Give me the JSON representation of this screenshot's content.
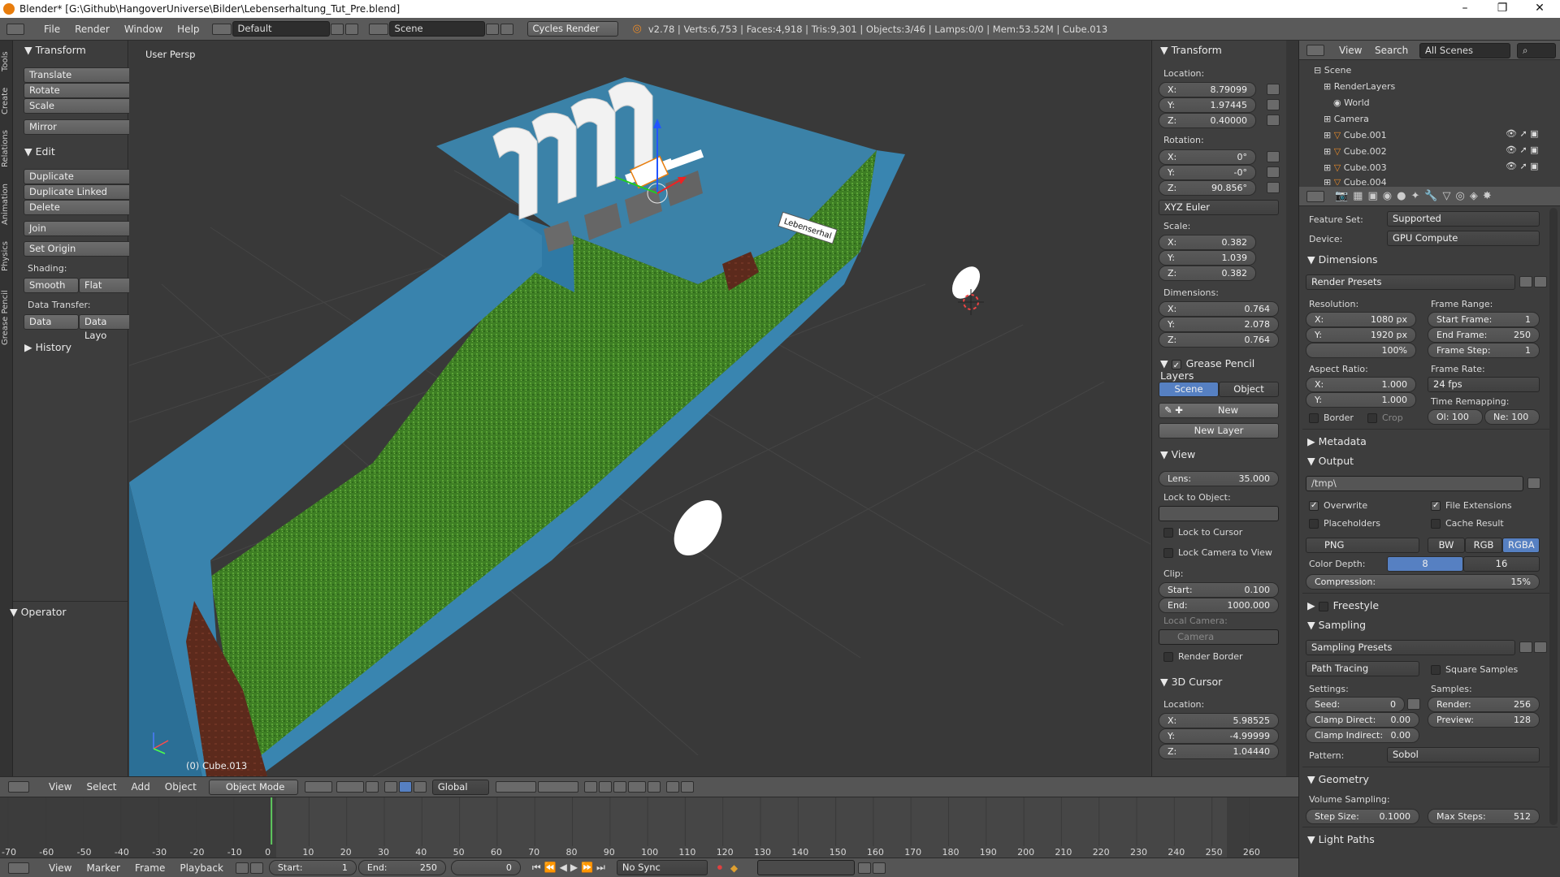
{
  "window": {
    "title": "Blender* [G:\\Github\\HangoverUniverse\\Bilder\\Lebenserhaltung_Tut_Pre.blend]",
    "minimize": "–",
    "maximize": "❐",
    "close": "✕"
  },
  "info_header": {
    "menus": [
      "File",
      "Render",
      "Window",
      "Help"
    ],
    "layout": "Default",
    "scene": "Scene",
    "engine": "Cycles Render",
    "stats": "v2.78 | Verts:6,753 | Faces:4,918 | Tris:9,301 | Objects:3/46 | Lamps:0/0 | Mem:53.52M | Cube.013"
  },
  "tool_tabs": [
    "Tools",
    "Create",
    "Relations",
    "Animation",
    "Physics",
    "Grease Pencil"
  ],
  "toolshelf": {
    "transform_header": "Transform",
    "transform_buttons": [
      "Translate",
      "Rotate",
      "Scale"
    ],
    "mirror": "Mirror",
    "edit_header": "Edit",
    "edit_buttons": [
      "Duplicate",
      "Duplicate Linked",
      "Delete"
    ],
    "join": "Join",
    "set_origin": "Set Origin",
    "shading_label": "Shading:",
    "smooth": "Smooth",
    "flat": "Flat",
    "data_transfer_label": "Data Transfer:",
    "data": "Data",
    "data_layo": "Data Layo",
    "history": "History",
    "operator": "Operator"
  },
  "viewport": {
    "persp_label": "User Persp",
    "object_label": "(0) Cube.013",
    "sign_text": "Lebenserhal"
  },
  "npanel": {
    "transform": "Transform",
    "location_label": "Location:",
    "loc": {
      "x": "8.79099",
      "y": "1.97445",
      "z": "0.40000"
    },
    "rotation_label": "Rotation:",
    "rot": {
      "x": "0°",
      "y": "-0°",
      "z": "90.856°"
    },
    "rot_mode": "XYZ Euler",
    "scale_label": "Scale:",
    "scale": {
      "x": "0.382",
      "y": "1.039",
      "z": "0.382"
    },
    "dimensions_label": "Dimensions:",
    "dim": {
      "x": "0.764",
      "y": "2.078",
      "z": "0.764"
    },
    "grease_pencil": "Grease Pencil Layers",
    "scene_tab": "Scene",
    "object_tab": "Object",
    "new": "New",
    "new_layer": "New Layer",
    "view": "View",
    "lens_label": "Lens:",
    "lens": "35.000",
    "lock_to_object": "Lock to Object:",
    "lock_to_cursor": "Lock to Cursor",
    "lock_camera": "Lock Camera to View",
    "clip_label": "Clip:",
    "clip_start_label": "Start:",
    "clip_start": "0.100",
    "clip_end_label": "End:",
    "clip_end": "1000.000",
    "local_camera": "Local Camera:",
    "camera": "Camera",
    "render_border": "Render Border",
    "cursor": "3D Cursor",
    "cursor_location": "Location:",
    "cur": {
      "x": "5.98525",
      "y": "-4.99999",
      "z": "1.04440"
    },
    "axis": {
      "x": "X:",
      "y": "Y:",
      "z": "Z:"
    }
  },
  "outliner": {
    "menus": [
      "View",
      "Search"
    ],
    "filter": "All Scenes",
    "items": [
      "Scene",
      "RenderLayers",
      "World",
      "Camera",
      "Cube.001",
      "Cube.002",
      "Cube.003",
      "Cube.004"
    ]
  },
  "properties": {
    "feature_set_label": "Feature Set:",
    "feature_set": "Supported",
    "device_label": "Device:",
    "device": "GPU Compute",
    "dimensions": "Dimensions",
    "render_presets": "Render Presets",
    "resolution_label": "Resolution:",
    "res_x": "1080 px",
    "res_y": "1920 px",
    "res_pct": "100%",
    "frame_range_label": "Frame Range:",
    "start_frame_label": "Start Frame:",
    "start_frame": "1",
    "end_frame_label": "End Frame:",
    "end_frame": "250",
    "frame_step_label": "Frame Step:",
    "frame_step": "1",
    "aspect_label": "Aspect Ratio:",
    "aspect_x": "1.000",
    "aspect_y": "1.000",
    "frame_rate_label": "Frame Rate:",
    "frame_rate": "24 fps",
    "time_remap_label": "Time Remapping:",
    "old": "Ol: 100",
    "new": "Ne: 100",
    "border": "Border",
    "crop": "Crop",
    "metadata": "Metadata",
    "output": "Output",
    "output_path": "/tmp\\",
    "overwrite": "Overwrite",
    "file_extensions": "File Extensions",
    "placeholders": "Placeholders",
    "cache_result": "Cache Result",
    "format": "PNG",
    "bw": "BW",
    "rgb": "RGB",
    "rgba": "RGBA",
    "color_depth_label": "Color Depth:",
    "depth8": "8",
    "depth16": "16",
    "compression_label": "Compression:",
    "compression": "15%",
    "freestyle": "Freestyle",
    "sampling": "Sampling",
    "sampling_presets": "Sampling Presets",
    "path_tracing": "Path Tracing",
    "square_samples": "Square Samples",
    "settings_label": "Settings:",
    "samples_label": "Samples:",
    "seed_label": "Seed:",
    "seed": "0",
    "render_label": "Render:",
    "render": "256",
    "clamp_direct_label": "Clamp Direct:",
    "clamp_direct": "0.00",
    "preview_label": "Preview:",
    "preview": "128",
    "clamp_indirect_label": "Clamp Indirect:",
    "clamp_indirect": "0.00",
    "pattern_label": "Pattern:",
    "pattern": "Sobol",
    "geometry": "Geometry",
    "volume_sampling": "Volume Sampling:",
    "step_size_label": "Step Size:",
    "step_size": "0.1000",
    "max_steps_label": "Max Steps:",
    "max_steps": "512",
    "light_paths": "Light Paths"
  },
  "viewport_header": {
    "menus": [
      "View",
      "Select",
      "Add",
      "Object"
    ],
    "mode": "Object Mode",
    "orientation": "Global"
  },
  "timeline": {
    "ticks": [
      "-70",
      "-60",
      "-50",
      "-40",
      "-30",
      "-20",
      "-10",
      "0",
      "10",
      "20",
      "30",
      "40",
      "50",
      "60",
      "70",
      "80",
      "90",
      "100",
      "110",
      "120",
      "130",
      "140",
      "150",
      "160",
      "170",
      "180",
      "190",
      "200",
      "210",
      "220",
      "230",
      "240",
      "250",
      "260"
    ],
    "current_frame_value": 0
  },
  "timeline_header": {
    "menus": [
      "View",
      "Marker",
      "Frame",
      "Playback"
    ],
    "start_label": "Start:",
    "start": "1",
    "end_label": "End:",
    "end": "250",
    "current": "0",
    "sync": "No Sync"
  }
}
